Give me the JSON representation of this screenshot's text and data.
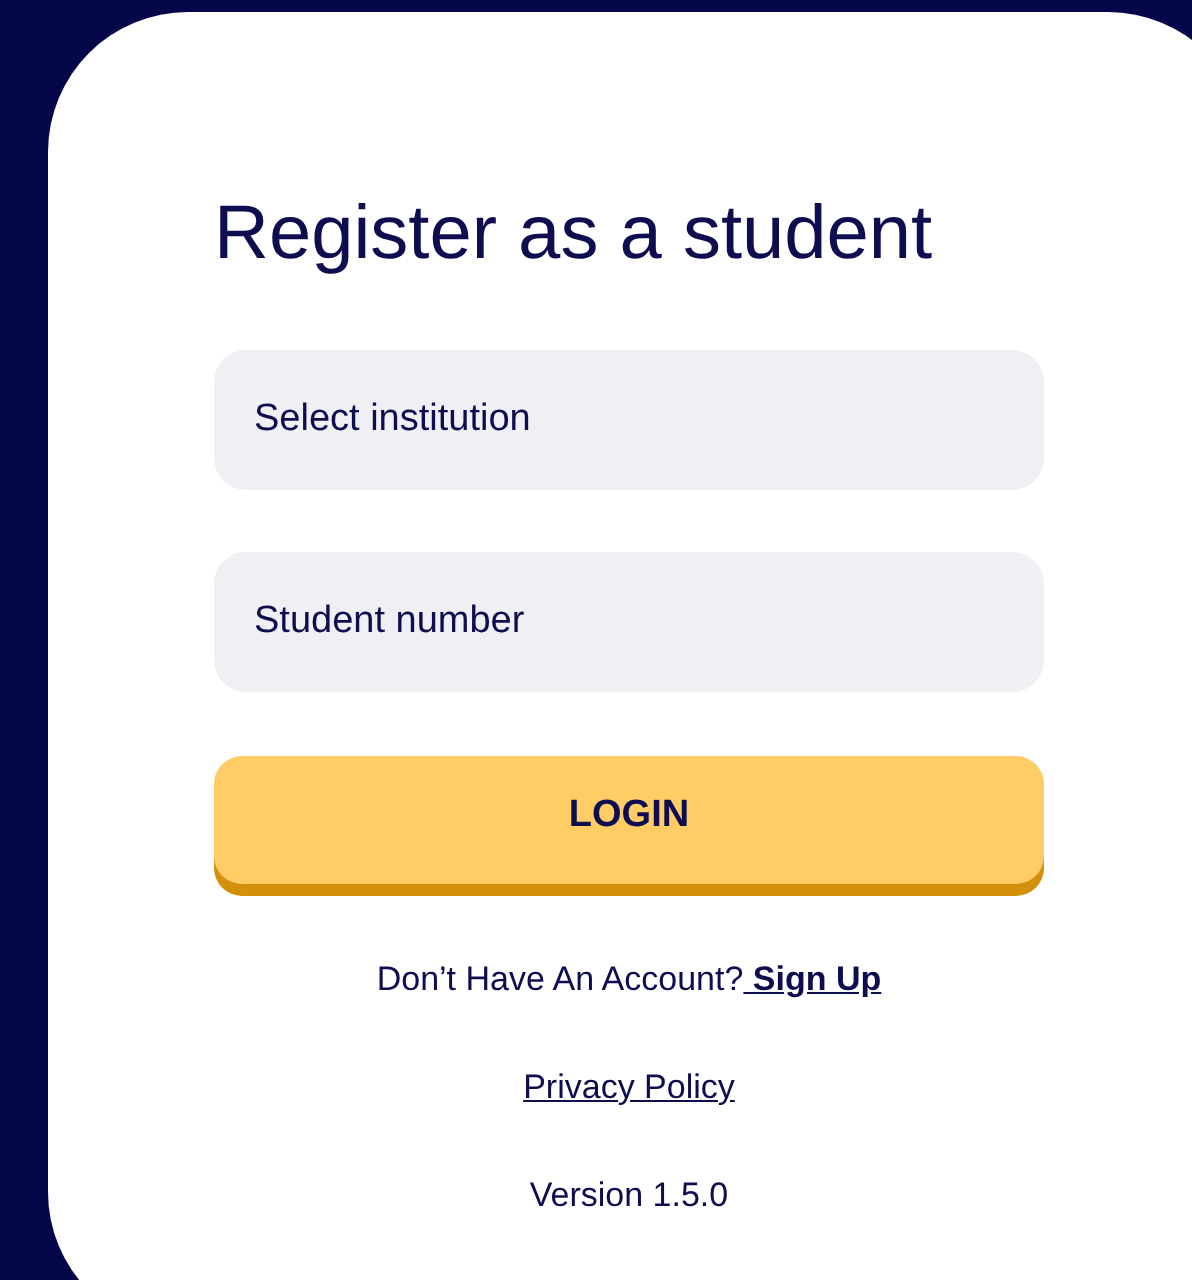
{
  "title": "Register as a student",
  "fields": [
    {
      "placeholder": "Select institution"
    },
    {
      "placeholder": "Student number"
    }
  ],
  "login_button": "LOGIN",
  "signup_prompt": {
    "text": "Don’t Have An Account?",
    "link": " Sign Up"
  },
  "privacy_link": "Privacy Policy",
  "version": "Version 1.5.0"
}
